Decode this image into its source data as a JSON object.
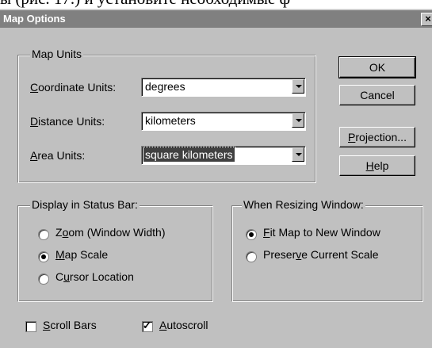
{
  "background_text": "ы (рис. 17.) и установите необходимые ф",
  "window": {
    "title": "Map Options",
    "close_glyph": "×"
  },
  "map_units": {
    "legend": "Map Units",
    "coordinate": {
      "pre": "",
      "key": "C",
      "post": "oordinate Units:",
      "value": "degrees"
    },
    "distance": {
      "pre": "",
      "key": "D",
      "post": "istance Units:",
      "value": "kilometers"
    },
    "area": {
      "pre": "",
      "key": "A",
      "post": "rea Units:",
      "value": "square kilometers"
    }
  },
  "buttons": {
    "ok": "OK",
    "cancel": "Cancel",
    "projection": {
      "pre": "",
      "key": "P",
      "post": "rojection..."
    },
    "help": {
      "pre": "",
      "key": "H",
      "post": "elp"
    }
  },
  "status_bar": {
    "legend": "Display in Status Bar:",
    "options": [
      {
        "pre": "Z",
        "key": "o",
        "post": "om (Window Width)",
        "selected": false
      },
      {
        "pre": "",
        "key": "M",
        "post": "ap Scale",
        "selected": true
      },
      {
        "pre": "C",
        "key": "u",
        "post": "rsor Location",
        "selected": false
      }
    ]
  },
  "resizing": {
    "legend": "When Resizing Window:",
    "options": [
      {
        "pre": "",
        "key": "F",
        "post": "it Map to New Window",
        "selected": true
      },
      {
        "pre": "Preser",
        "key": "v",
        "post": "e Current Scale",
        "selected": false
      }
    ]
  },
  "checkboxes": {
    "scroll_bars": {
      "pre": "",
      "key": "S",
      "post": "croll Bars",
      "checked": false
    },
    "autoscroll": {
      "pre": "",
      "key": "A",
      "post": "utoscroll",
      "checked": true,
      "mark": "✓"
    }
  }
}
